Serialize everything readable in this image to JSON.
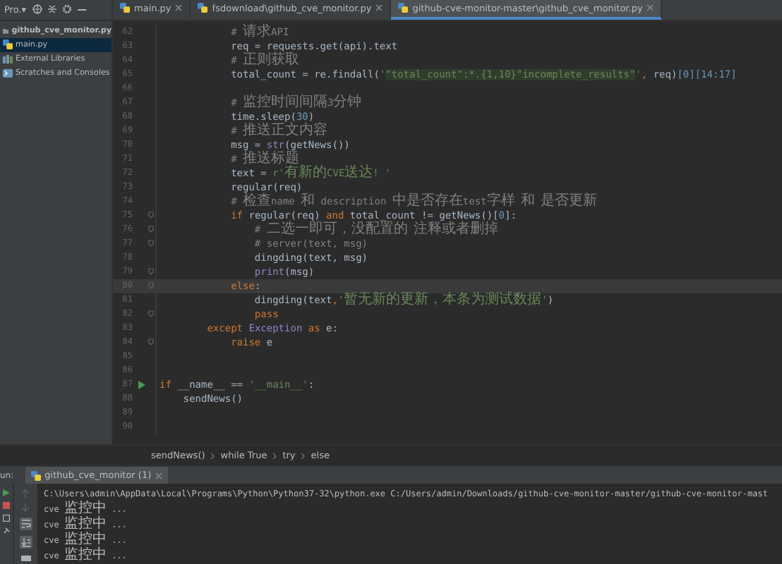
{
  "project_panel": {
    "title": "Pro.▾",
    "items": [
      {
        "label": "github_cve_monitor.py",
        "kind": "project",
        "selected": false
      },
      {
        "label": "main.py",
        "kind": "file",
        "selected": true
      },
      {
        "label": "External Libraries",
        "kind": "library",
        "selected": false
      },
      {
        "label": "Scratches and Consoles",
        "kind": "scratch",
        "selected": false
      }
    ]
  },
  "tabs": [
    {
      "label": "main.py",
      "selected": false
    },
    {
      "label": "fsdownload\\github_cve_monitor.py",
      "selected": false
    },
    {
      "label": "github-cve-monitor-master\\github_cve_monitor.py",
      "selected": true
    }
  ],
  "editor": {
    "lines": [
      {
        "number": "62",
        "current": false,
        "fold": false,
        "run": false,
        "tokens": [
          {
            "kind": "comment",
            "text": "            # 请求API"
          }
        ]
      },
      {
        "number": "63",
        "current": false,
        "fold": false,
        "run": false,
        "tokens": [
          {
            "kind": "plain",
            "text": "            req = requests.get(api).text"
          }
        ]
      },
      {
        "number": "64",
        "current": false,
        "fold": false,
        "run": false,
        "tokens": [
          {
            "kind": "comment",
            "text": "            # 正则获取"
          }
        ]
      },
      {
        "number": "65",
        "current": false,
        "fold": false,
        "run": false,
        "tokens": [
          {
            "kind": "plain",
            "text": "            total_count = re.findall("
          },
          {
            "kind": "string",
            "text": "'"
          },
          {
            "kind": "match",
            "text": "\"total_count\":*.{1,10}\"incomplete_results\""
          },
          {
            "kind": "string",
            "text": "'"
          },
          {
            "kind": "keyword",
            "text": ","
          },
          {
            "kind": "plain",
            "text": " req)"
          },
          {
            "kind": "number",
            "text": "[0][14:17]"
          }
        ]
      },
      {
        "number": "66",
        "current": false,
        "fold": false,
        "run": false
      },
      {
        "number": "67",
        "current": false,
        "fold": false,
        "run": false,
        "tokens": [
          {
            "kind": "comment",
            "text": "            # 监控时间间隔3分钟"
          }
        ]
      },
      {
        "number": "68",
        "current": false,
        "fold": false,
        "run": false,
        "tokens": [
          {
            "kind": "plain",
            "text": "            time.sleep("
          },
          {
            "kind": "number",
            "text": "30"
          },
          {
            "kind": "plain",
            "text": ")"
          }
        ]
      },
      {
        "number": "69",
        "current": false,
        "fold": false,
        "run": false,
        "tokens": [
          {
            "kind": "comment",
            "text": "            # 推送正文内容"
          }
        ]
      },
      {
        "number": "70",
        "current": false,
        "fold": false,
        "run": false,
        "tokens": [
          {
            "kind": "plain",
            "text": "            msg = "
          },
          {
            "kind": "builtin",
            "text": "str"
          },
          {
            "kind": "plain",
            "text": "(getNews())"
          }
        ]
      },
      {
        "number": "71",
        "current": false,
        "fold": false,
        "run": false,
        "tokens": [
          {
            "kind": "comment",
            "text": "            # 推送标题"
          }
        ]
      },
      {
        "number": "72",
        "current": false,
        "fold": false,
        "run": false,
        "tokens": [
          {
            "kind": "plain",
            "text": "            text = "
          },
          {
            "kind": "string",
            "text": "r'有新的CVE送达! '"
          }
        ]
      },
      {
        "number": "73",
        "current": false,
        "fold": false,
        "run": false,
        "tokens": [
          {
            "kind": "plain",
            "text": "            regular(req)"
          }
        ]
      },
      {
        "number": "74",
        "current": false,
        "fold": false,
        "run": false,
        "tokens": [
          {
            "kind": "comment",
            "text": "            # 检查name 和 description 中是否存在test字样 和 是否更新"
          }
        ]
      },
      {
        "number": "75",
        "current": false,
        "fold": true,
        "run": false,
        "tokens": [
          {
            "kind": "keyword",
            "text": "            if"
          },
          {
            "kind": "plain",
            "text": " regular(req) "
          },
          {
            "kind": "keyword",
            "text": "and"
          },
          {
            "kind": "plain",
            "text": " total_count != getNews()["
          },
          {
            "kind": "number",
            "text": "0"
          },
          {
            "kind": "plain",
            "text": "]:"
          }
        ]
      },
      {
        "number": "76",
        "current": false,
        "fold": true,
        "run": false,
        "tokens": [
          {
            "kind": "comment",
            "text": "                # 二选一即可，没配置的 注释或者删掉"
          }
        ]
      },
      {
        "number": "77",
        "current": false,
        "fold": true,
        "run": false,
        "tokens": [
          {
            "kind": "comment",
            "text": "                # server(text, msg)"
          }
        ]
      },
      {
        "number": "78",
        "current": false,
        "fold": false,
        "run": false,
        "tokens": [
          {
            "kind": "plain",
            "text": "                dingding(text, msg)"
          }
        ]
      },
      {
        "number": "79",
        "current": false,
        "fold": true,
        "run": false,
        "tokens": [
          {
            "kind": "builtin",
            "text": "                print"
          },
          {
            "kind": "plain",
            "text": "(msg)"
          }
        ]
      },
      {
        "number": "80",
        "current": true,
        "fold": true,
        "run": false,
        "tokens": [
          {
            "kind": "keyword",
            "text": "            else"
          },
          {
            "kind": "plain",
            "text": ":"
          }
        ]
      },
      {
        "number": "81",
        "current": false,
        "fold": false,
        "run": false,
        "tokens": [
          {
            "kind": "plain",
            "text": "                dingding(text"
          },
          {
            "kind": "keyword",
            "text": ","
          },
          {
            "kind": "string",
            "text": "'暂无新的更新，本条为测试数据'"
          },
          {
            "kind": "plain",
            "text": ")"
          }
        ]
      },
      {
        "number": "82",
        "current": false,
        "fold": true,
        "run": false,
        "tokens": [
          {
            "kind": "keyword",
            "text": "                pass"
          }
        ]
      },
      {
        "number": "83",
        "current": false,
        "fold": false,
        "run": false,
        "tokens": [
          {
            "kind": "keyword",
            "text": "        except"
          },
          {
            "kind": "builtin",
            "text": " Exception"
          },
          {
            "kind": "keyword",
            "text": " as"
          },
          {
            "kind": "plain",
            "text": " e:"
          }
        ]
      },
      {
        "number": "84",
        "current": false,
        "fold": true,
        "run": false,
        "tokens": [
          {
            "kind": "keyword",
            "text": "            raise"
          },
          {
            "kind": "plain",
            "text": " e"
          }
        ]
      },
      {
        "number": "85",
        "current": false,
        "fold": false,
        "run": false
      },
      {
        "number": "86",
        "current": false,
        "fold": false,
        "run": false
      },
      {
        "number": "87",
        "current": false,
        "fold": false,
        "run": true,
        "tokens": [
          {
            "kind": "keyword",
            "text": "if"
          },
          {
            "kind": "plain",
            "text": " __name__ == "
          },
          {
            "kind": "string",
            "text": "'__main__'"
          },
          {
            "kind": "plain",
            "text": ":"
          }
        ]
      },
      {
        "number": "88",
        "current": false,
        "fold": false,
        "run": false,
        "tokens": [
          {
            "kind": "plain",
            "text": "    sendNews()"
          }
        ]
      },
      {
        "number": "89",
        "current": false,
        "fold": false,
        "run": false
      },
      {
        "number": "90",
        "current": false,
        "fold": false,
        "run": false
      }
    ]
  },
  "breadcrumbs": [
    "sendNews()",
    "while True",
    "try",
    "else"
  ],
  "run_panel": {
    "label": "un:",
    "tab": "github_cve_monitor (1)",
    "output": [
      "C:\\Users\\admin\\AppData\\Local\\Programs\\Python\\Python37-32\\python.exe C:/Users/admin/Downloads/github-cve-monitor-master/github-cve-monitor-mast",
      "cve 监控中 ...",
      "cve 监控中 ...",
      "cve 监控中 ...",
      "cve 监控中 ..."
    ]
  }
}
